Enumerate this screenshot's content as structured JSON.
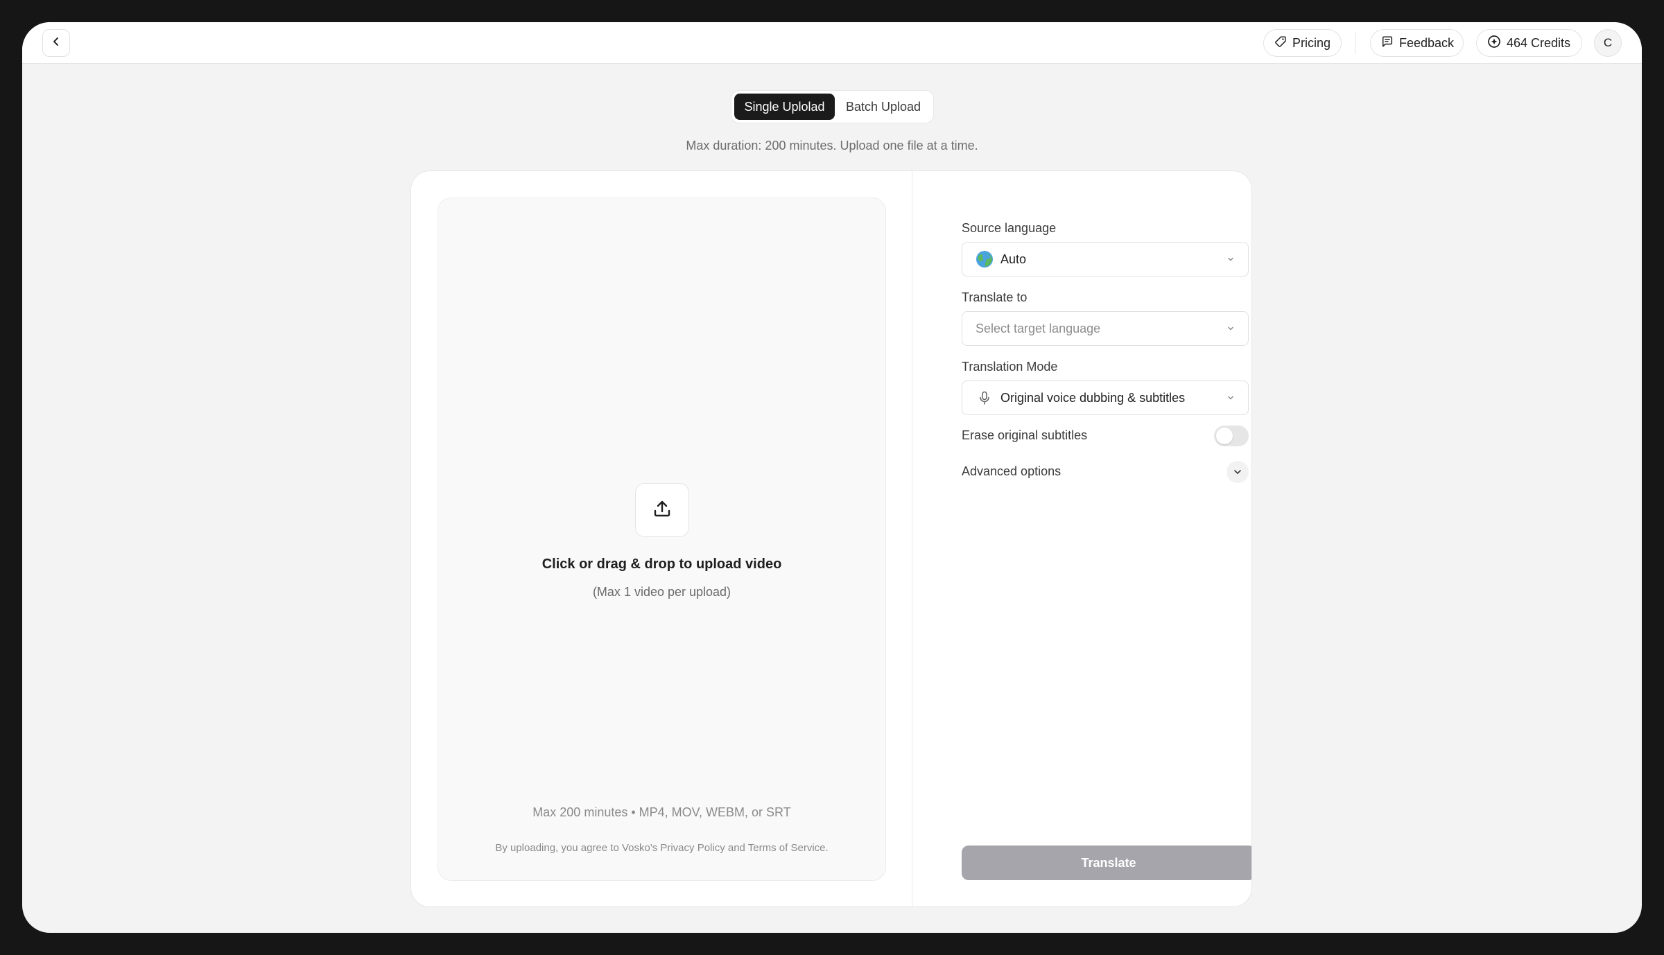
{
  "header": {
    "back_icon": "chevron-left-icon",
    "pricing": {
      "label": "Pricing",
      "icon": "tag-icon"
    },
    "feedback": {
      "label": "Feedback",
      "icon": "message-square-icon"
    },
    "credits": {
      "label": "464 Credits",
      "icon": "plus-circle-icon"
    },
    "avatar_initial": "C"
  },
  "upload_tabs": {
    "items": [
      {
        "label": "Single Uplolad",
        "active": true
      },
      {
        "label": "Batch Upload",
        "active": false
      }
    ]
  },
  "subtitle": "Max duration: 200 minutes. Upload one file at a time.",
  "dropzone": {
    "icon": "upload-icon",
    "title": "Click or drag & drop to upload video",
    "subtitle": "(Max 1 video per upload)",
    "formats": "Max 200 minutes • MP4, MOV, WEBM, or SRT",
    "legal": "By uploading, you agree to Vosko's Privacy Policy and Terms of Service."
  },
  "settings": {
    "source_language": {
      "label": "Source language",
      "value": "Auto",
      "icon": "globe-icon"
    },
    "translate_to": {
      "label": "Translate to",
      "placeholder": "Select target language"
    },
    "translation_mode": {
      "label": "Translation Mode",
      "value": "Original voice dubbing & subtitles",
      "icon": "microphone-icon"
    },
    "erase_subtitles": {
      "label": "Erase original subtitles",
      "enabled": false
    },
    "advanced_options": {
      "label": "Advanced options",
      "expanded": false
    }
  },
  "translate_button": {
    "label": "Translate",
    "disabled": true
  },
  "colors": {
    "active_tab": "#1b1b1b",
    "button_disabled": "#a5a5ab",
    "background": "#f3f3f3"
  }
}
